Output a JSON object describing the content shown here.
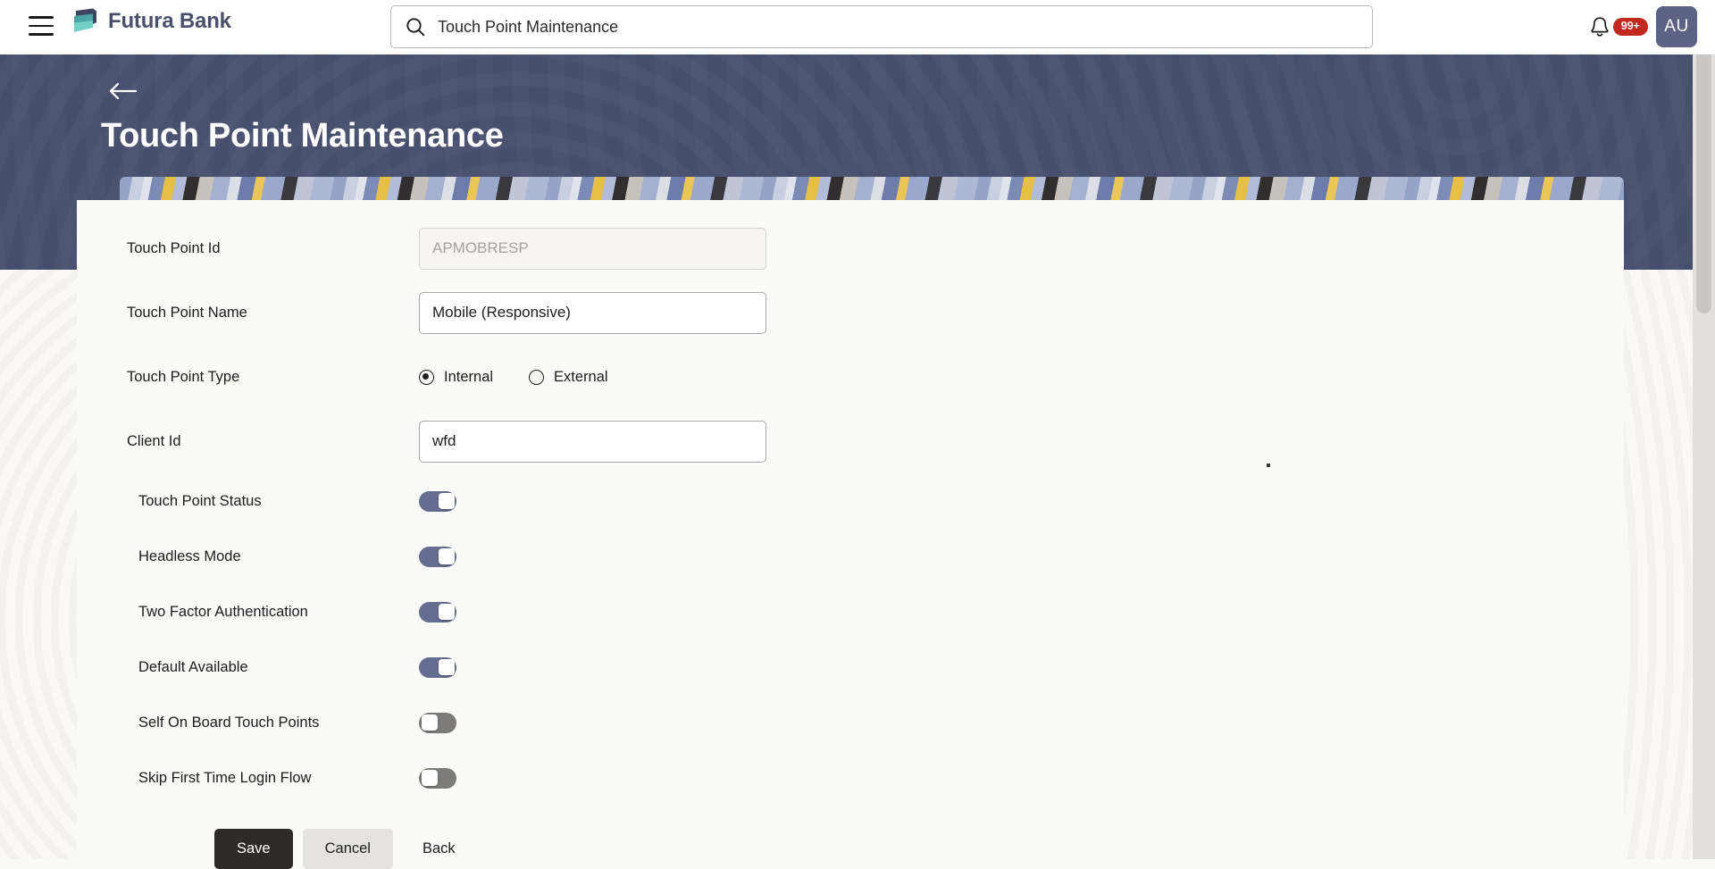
{
  "header": {
    "menu_icon": "hamburger-menu-icon",
    "brand_name": "Futura Bank",
    "brand_logo_icon": "futura-bank-logo-icon",
    "search": {
      "icon": "search-icon",
      "value": "Touch Point Maintenance",
      "placeholder": "Search"
    },
    "notification_icon": "bell-icon",
    "notification_count": "99+",
    "avatar_initials": "AU"
  },
  "hero": {
    "back_icon": "back-arrow-icon",
    "title": "Touch Point Maintenance"
  },
  "form": {
    "fields": [
      {
        "label": "Touch Point Id",
        "name": "touch-point-id",
        "type": "text",
        "value": "",
        "placeholder": "APMOBRESP",
        "disabled": true
      },
      {
        "label": "Touch Point Name",
        "name": "touch-point-name",
        "type": "text",
        "value": "Mobile (Responsive)",
        "placeholder": "",
        "disabled": false
      },
      {
        "label": "Touch Point Type",
        "name": "touch-point-type",
        "type": "radio",
        "options": [
          {
            "label": "Internal",
            "selected": true
          },
          {
            "label": "External",
            "selected": false
          }
        ]
      },
      {
        "label": "Client Id",
        "name": "client-id",
        "type": "text",
        "value": "wfd",
        "placeholder": "",
        "disabled": false
      }
    ],
    "toggles": [
      {
        "label": "Touch Point Status",
        "name": "touch-point-status",
        "on": true
      },
      {
        "label": "Headless Mode",
        "name": "headless-mode",
        "on": true
      },
      {
        "label": "Two Factor Authentication",
        "name": "two-factor-authentication",
        "on": true
      },
      {
        "label": "Default Available",
        "name": "default-available",
        "on": true
      },
      {
        "label": "Self On Board Touch Points",
        "name": "self-on-board-touch-points",
        "on": false
      },
      {
        "label": "Skip First Time Login Flow",
        "name": "skip-first-time-login-flow",
        "on": false
      }
    ],
    "actions": {
      "save": "Save",
      "cancel": "Cancel",
      "back": "Back"
    }
  },
  "colors": {
    "hero_band": "#474f6e",
    "brand_text": "#49506b",
    "badge_red": "#c1281e",
    "avatar_bg": "#5c6384",
    "toggle_on": "#656d91",
    "toggle_off": "#7d7b79",
    "primary_button": "#2d2a28",
    "secondary_button": "#e5e3e0",
    "page_bg": "#faf9f7",
    "card_bg": "#fafaf8"
  }
}
